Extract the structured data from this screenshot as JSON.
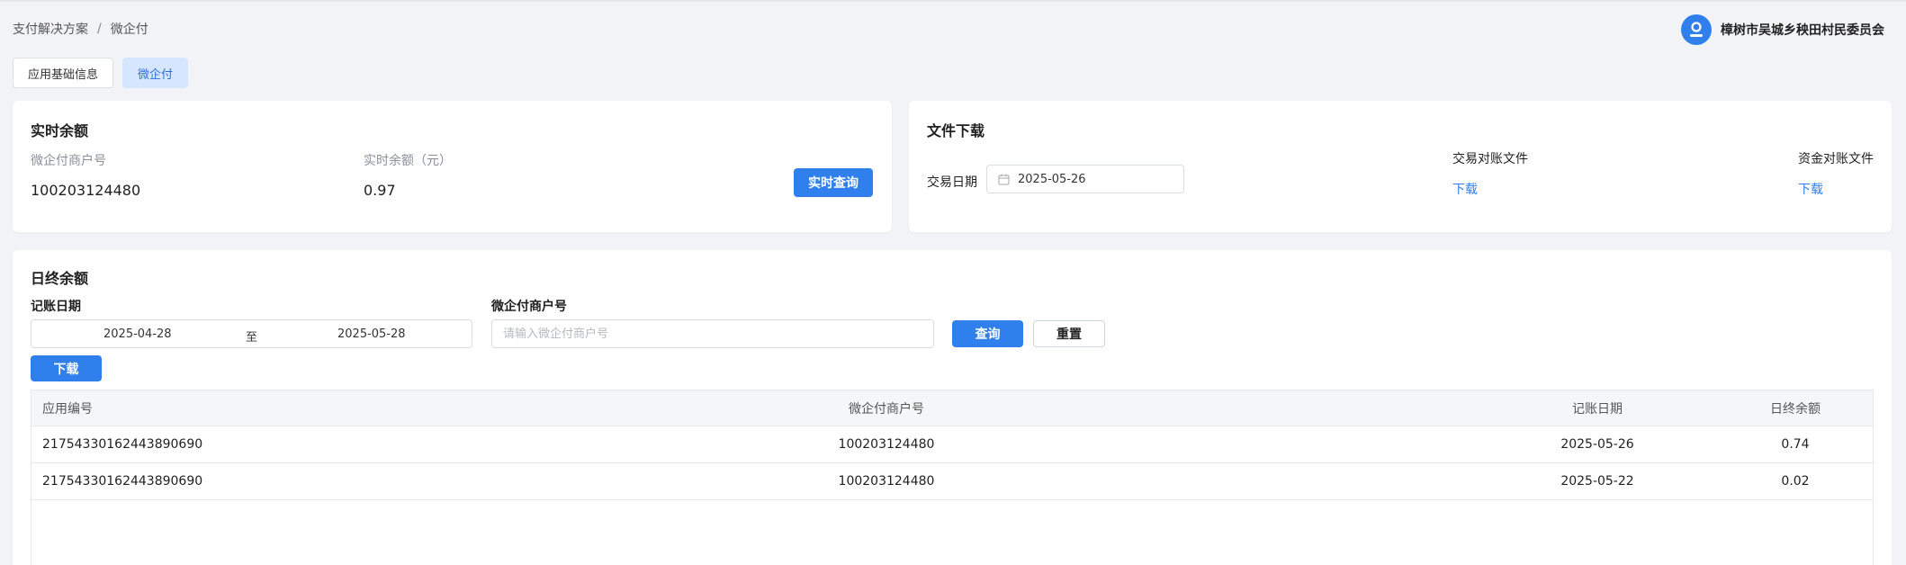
{
  "breadcrumb": {
    "parent": "支付解决方案",
    "separator": "/",
    "current": "微企付"
  },
  "user": {
    "name": "樟树市吴城乡秧田村民委员会"
  },
  "tabs": [
    {
      "label": "应用基础信息",
      "active": false
    },
    {
      "label": "微企付",
      "active": true
    }
  ],
  "realtime": {
    "title": "实时余额",
    "merchant_label": "微企付商户号",
    "merchant_value": "100203124480",
    "balance_label": "实时余额（元）",
    "balance_value": "0.97",
    "query_button": "实时查询"
  },
  "file_download": {
    "title": "文件下载",
    "date_label": "交易日期",
    "date_value": "2025-05-26",
    "trade_file_label": "交易对账文件",
    "trade_file_link": "下载",
    "fund_file_label": "资金对账文件",
    "fund_file_link": "下载"
  },
  "daily": {
    "title": "日终余额",
    "date_label": "记账日期",
    "date_start": "2025-04-28",
    "date_to": "至",
    "date_end": "2025-05-28",
    "merchant_label": "微企付商户号",
    "merchant_placeholder": "请输入微企付商户号",
    "query_button": "查询",
    "reset_button": "重置",
    "download_button": "下载",
    "columns": [
      "应用编号",
      "微企付商户号",
      "记账日期",
      "日终余额"
    ],
    "rows": [
      [
        "21754330162443890690",
        "100203124480",
        "2025-05-26",
        "0.74"
      ],
      [
        "21754330162443890690",
        "100203124480",
        "2025-05-22",
        "0.02"
      ]
    ]
  },
  "colors": {
    "primary": "#2f80ed",
    "tab_active_bg": "#d6e6ff",
    "background": "#f2f3f6"
  }
}
